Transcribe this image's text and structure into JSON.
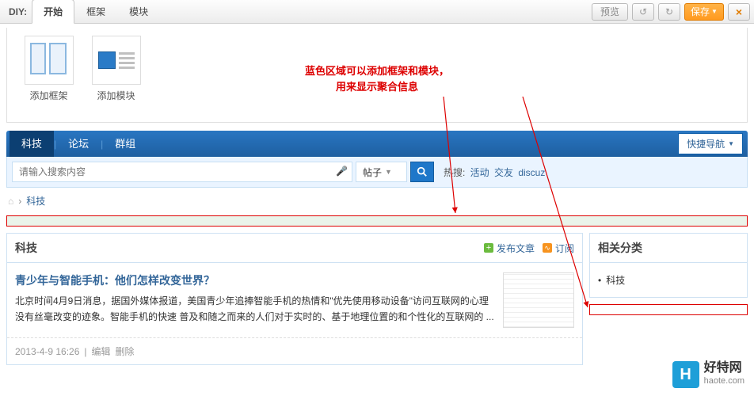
{
  "toolbar": {
    "diy_label": "DIY:",
    "tabs": [
      "开始",
      "框架",
      "模块"
    ],
    "preview": "预览",
    "save": "保存"
  },
  "diy_panel": {
    "add_frame": "添加框架",
    "add_module": "添加模块"
  },
  "annotation": {
    "line1": "蓝色区域可以添加框架和模块，",
    "line2": "用来显示聚合信息"
  },
  "nav": {
    "tabs": [
      "科技",
      "论坛",
      "群组"
    ],
    "quick": "快捷导航"
  },
  "search": {
    "placeholder": "请输入搜索内容",
    "scope": "帖子",
    "hot_label": "热搜:",
    "hot_items": [
      "活动",
      "交友",
      "discuz"
    ]
  },
  "breadcrumb": {
    "item": "科技",
    "sep": "›"
  },
  "section": {
    "title": "科技",
    "publish": "发布文章",
    "subscribe": "订阅"
  },
  "sidebar": {
    "title": "相关分类",
    "items": [
      "科技"
    ]
  },
  "article": {
    "title": "青少年与智能手机：他们怎样改变世界？",
    "summary": "北京时间4月9日消息，据国外媒体报道，美国青少年追捧智能手机的热情和\"优先使用移动设备\"访问互联网的心理没有丝毫改变的迹象。智能手机的快速 普及和随之而来的人们对于实时的、基于地理位置的和个性化的互联网的 ...",
    "date": "2013-4-9 16:26",
    "edit": "编辑",
    "delete": "删除"
  },
  "watermark": {
    "cn": "好特网",
    "en": "haote.com"
  }
}
